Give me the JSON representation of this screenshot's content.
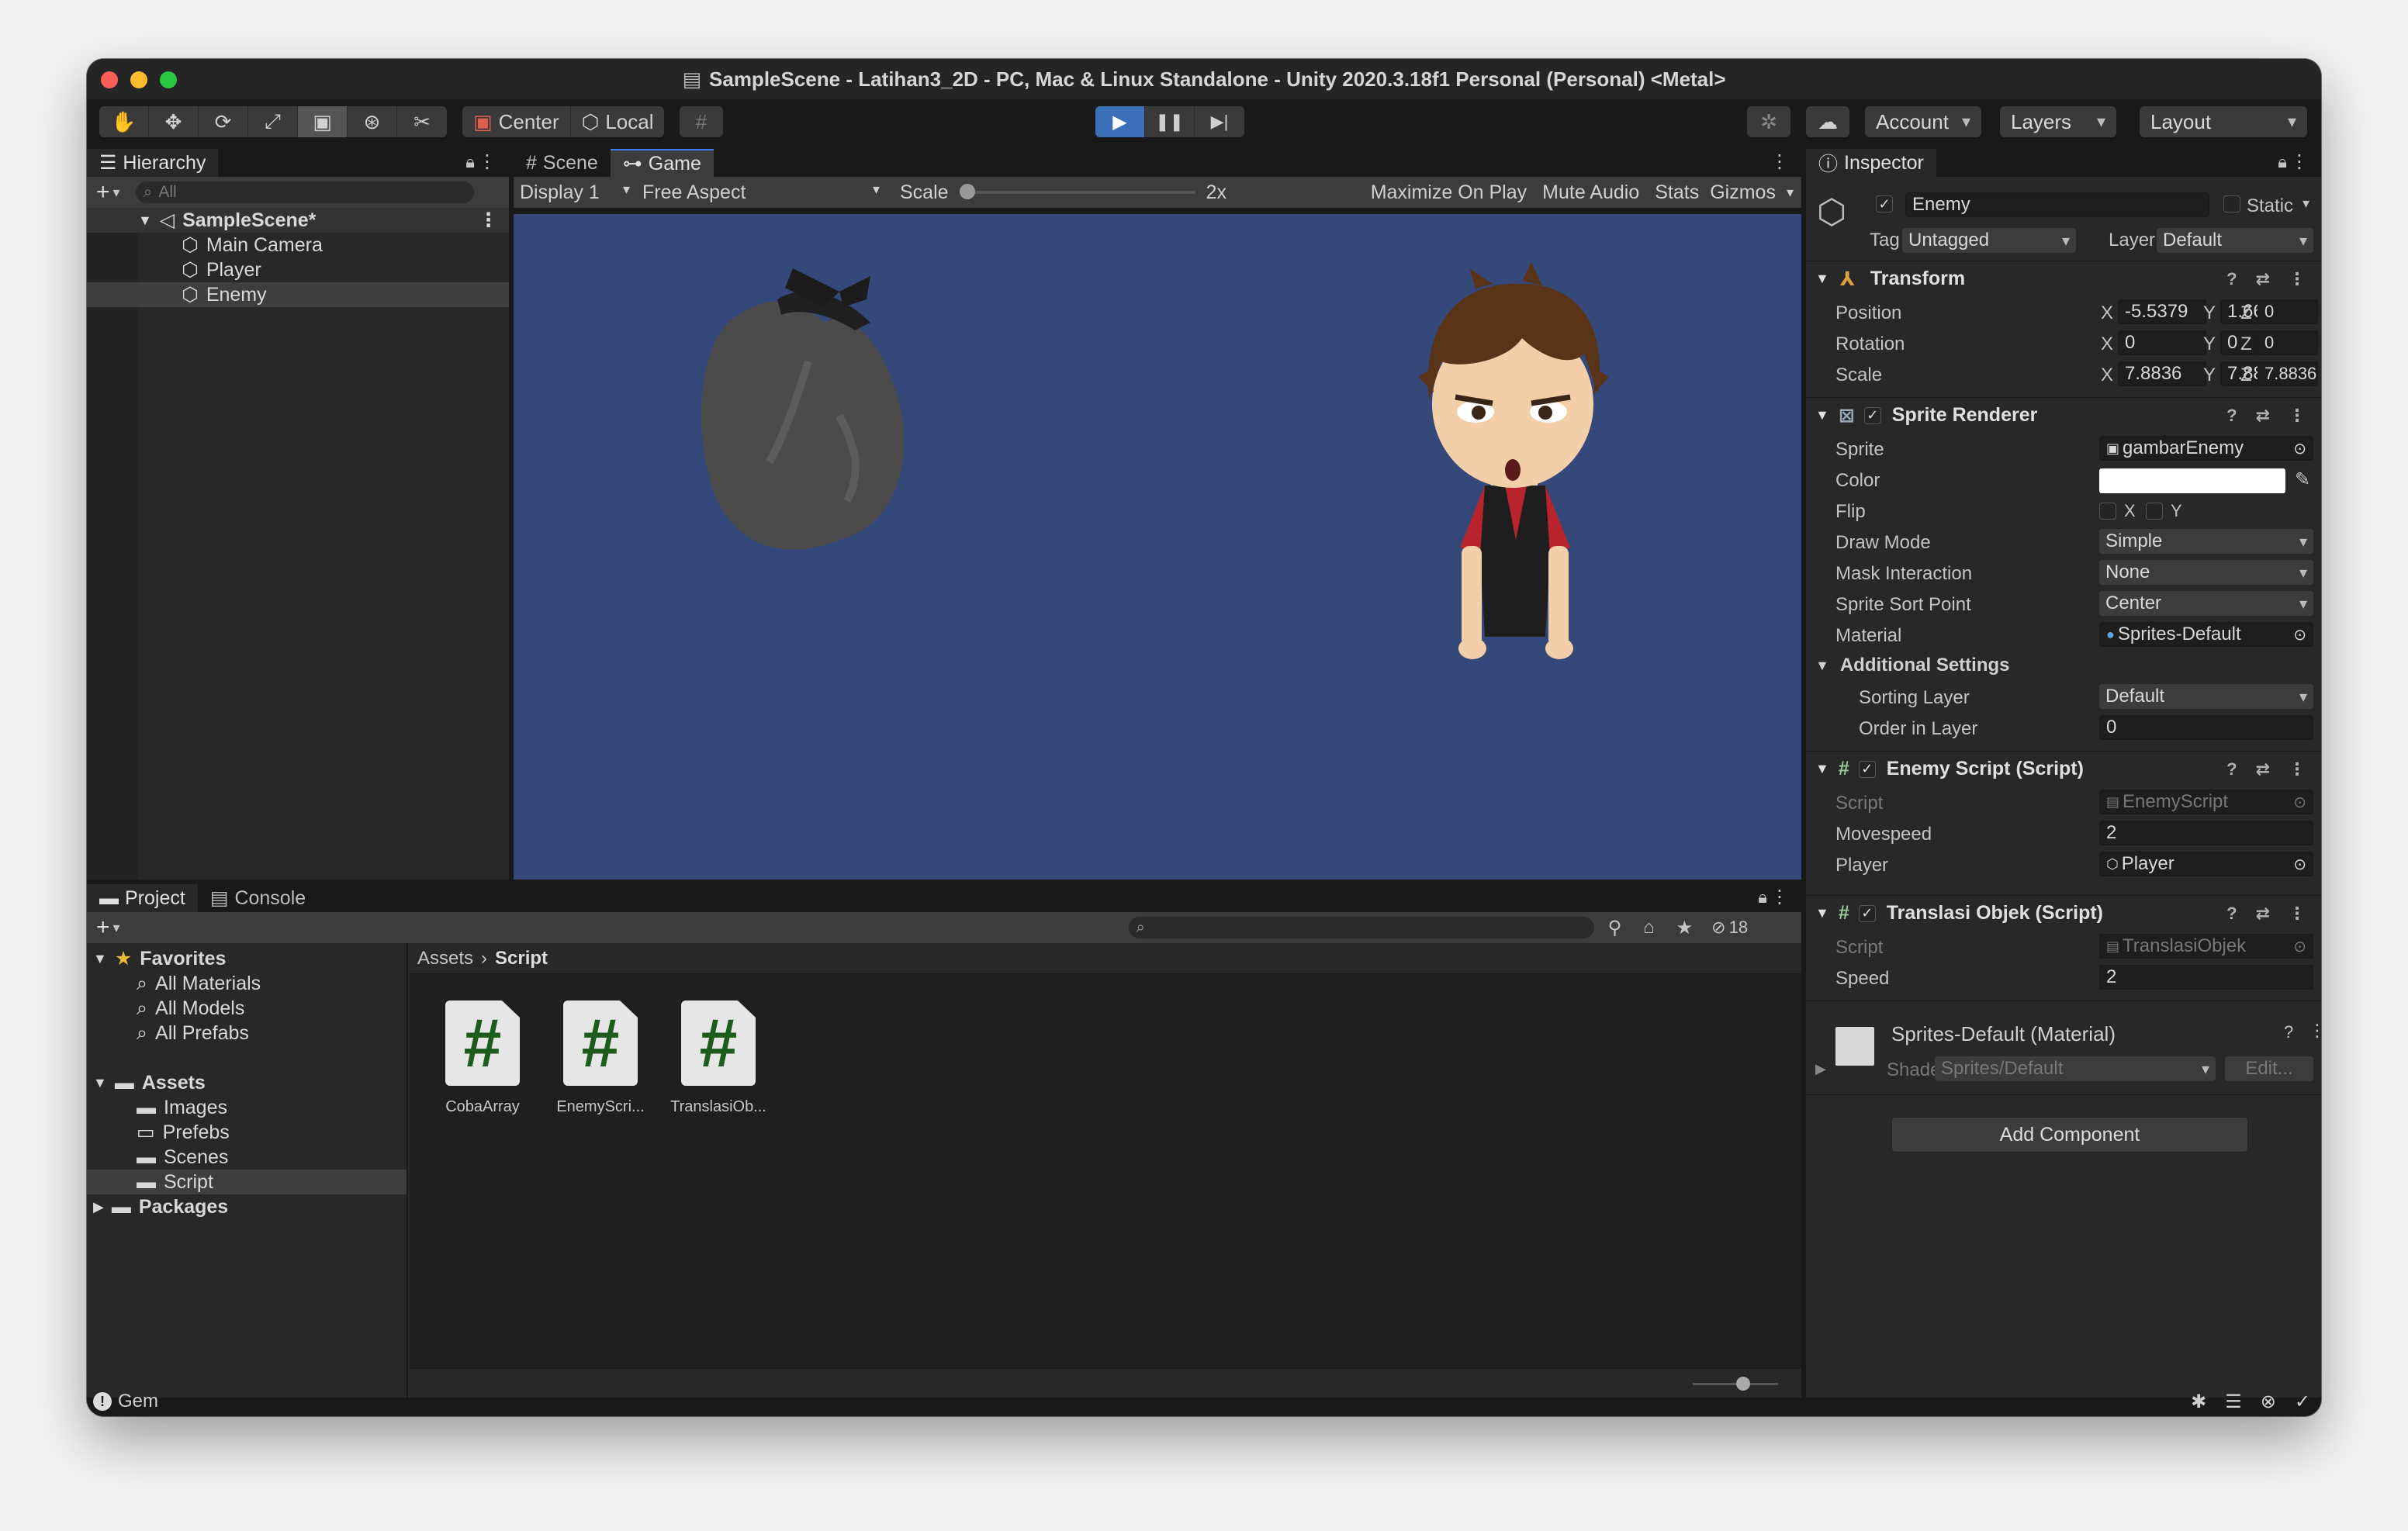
{
  "window": {
    "title": "SampleScene - Latihan3_2D - PC, Mac & Linux Standalone - Unity 2020.3.18f1 Personal (Personal) <Metal>"
  },
  "toolbar": {
    "pivot_mode": "Center",
    "pivot_rotation": "Local",
    "account": "Account",
    "layers": "Layers",
    "layout": "Layout"
  },
  "hierarchy": {
    "tab": "Hierarchy",
    "search_placeholder": "All",
    "scene": "SampleScene*",
    "items": [
      "Main Camera",
      "Player",
      "Enemy"
    ]
  },
  "game": {
    "tabs": [
      "Scene",
      "Game"
    ],
    "display": "Display 1",
    "aspect": "Free Aspect",
    "scale_label": "Scale",
    "scale_value": "2x",
    "options": [
      "Maximize On Play",
      "Mute Audio",
      "Stats",
      "Gizmos"
    ]
  },
  "project": {
    "tabs": [
      "Project",
      "Console"
    ],
    "hidden_count": "18",
    "favorites_label": "Favorites",
    "favorites": [
      "All Materials",
      "All Models",
      "All Prefabs"
    ],
    "assets_label": "Assets",
    "asset_folders": [
      "Images",
      "Prefebs",
      "Scenes",
      "Script"
    ],
    "packages_label": "Packages",
    "breadcrumb": [
      "Assets",
      "Script"
    ],
    "files": [
      "CobaArray",
      "EnemyScri...",
      "TranslasiOb..."
    ]
  },
  "status": {
    "text": "Gem"
  },
  "inspector": {
    "tab": "Inspector",
    "object_name": "Enemy",
    "static_label": "Static",
    "tag_label": "Tag",
    "tag": "Untagged",
    "layer_label": "Layer",
    "layer": "Default",
    "transform": {
      "title": "Transform",
      "position_label": "Position",
      "rotation_label": "Rotation",
      "scale_label": "Scale",
      "position": [
        "-5.5379",
        "1.66206",
        "0"
      ],
      "rotation": [
        "0",
        "0",
        "0"
      ],
      "scale": [
        "7.8836",
        "7.8836",
        "7.8836"
      ],
      "axes": [
        "X",
        "Y",
        "Z"
      ]
    },
    "sprite_renderer": {
      "title": "Sprite Renderer",
      "labels": {
        "sprite": "Sprite",
        "color": "Color",
        "flip": "Flip",
        "draw_mode": "Draw Mode",
        "mask": "Mask Interaction",
        "sort_point": "Sprite Sort Point",
        "material": "Material",
        "additional": "Additional Settings",
        "sorting_layer": "Sorting Layer",
        "order": "Order in Layer"
      },
      "sprite": "gambarEnemy",
      "color": "#ffffff",
      "flip_x": "X",
      "flip_y": "Y",
      "draw_mode": "Simple",
      "mask": "None",
      "sort_point": "Center",
      "material": "Sprites-Default",
      "sorting_layer": "Default",
      "order": "0"
    },
    "enemy_script": {
      "title": "Enemy Script (Script)",
      "script_label": "Script",
      "script": "EnemyScript",
      "movespeed_label": "Movespeed",
      "movespeed": "2",
      "player_label": "Player",
      "player": "Player"
    },
    "translasi": {
      "title": "Translasi Objek (Script)",
      "script_label": "Script",
      "script": "TranslasiObjek",
      "speed_label": "Speed",
      "speed": "2"
    },
    "material": {
      "title": "Sprites-Default (Material)",
      "shader_label": "Shader",
      "shader": "Sprites/Default",
      "edit": "Edit..."
    },
    "add_component": "Add Component"
  }
}
